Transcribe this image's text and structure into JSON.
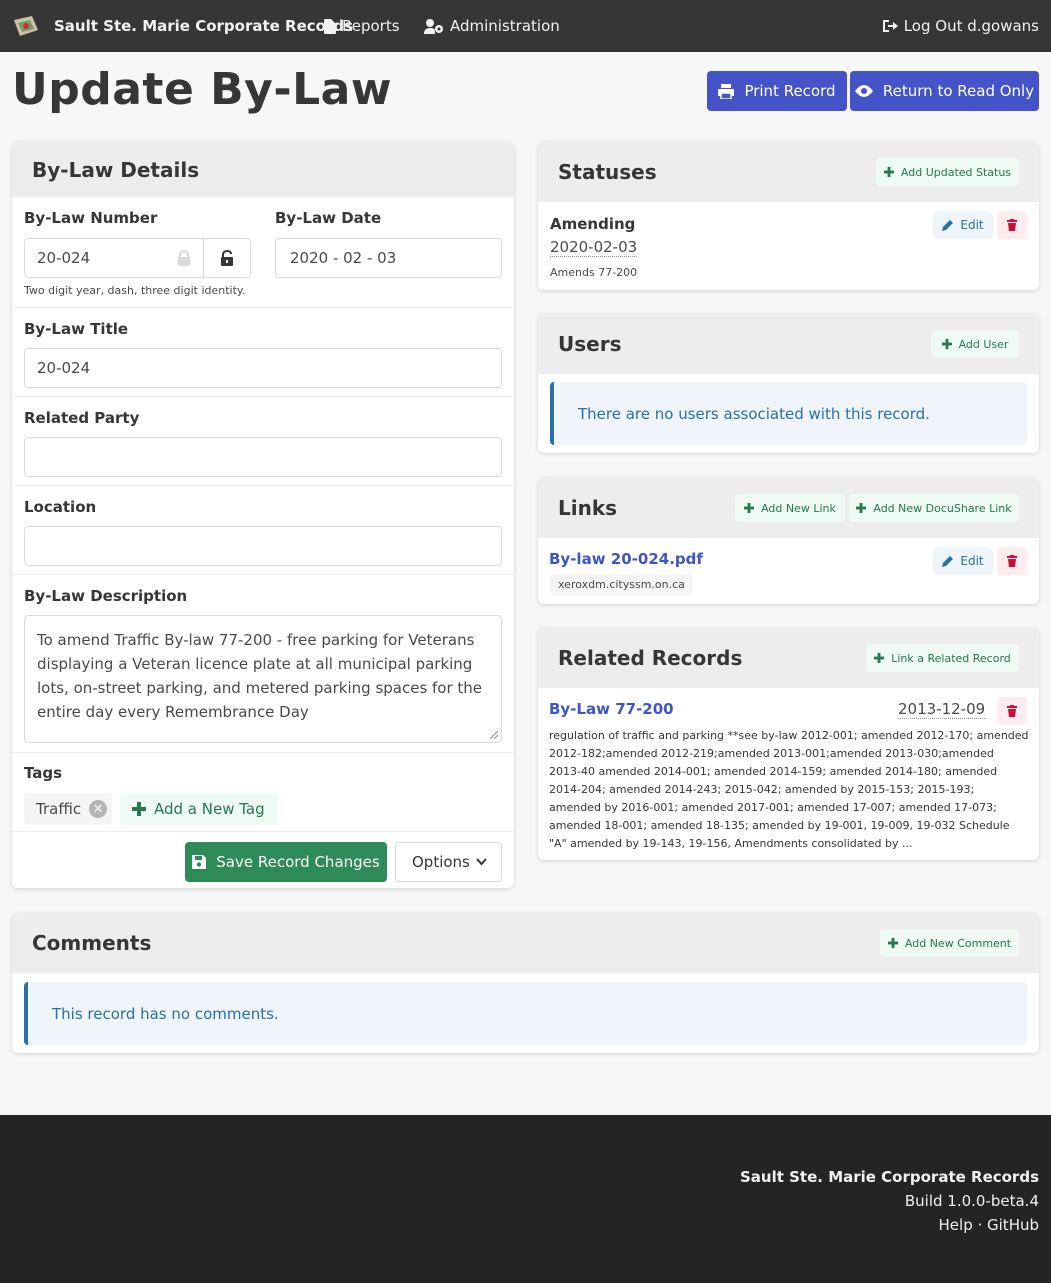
{
  "navbar": {
    "brand": "Sault Ste. Marie Corporate Records",
    "reports": "Reports",
    "administration": "Administration",
    "logout": "Log Out d.gowans"
  },
  "page": {
    "title": "Update By-Law",
    "print_button": "Print Record",
    "readonly_button": "Return to Read Only"
  },
  "details": {
    "heading": "By-Law Details",
    "number_label": "By-Law Number",
    "number_value": "20-024",
    "number_help": "Two digit year, dash, three digit identity.",
    "date_label": "By-Law Date",
    "date_value": "2020 - 02 - 03",
    "title_label": "By-Law Title",
    "title_value": "20-024",
    "party_label": "Related Party",
    "party_value": "",
    "location_label": "Location",
    "location_value": "",
    "description_label": "By-Law Description",
    "description_value": "To amend Traffic By-law 77-200 - free parking for Veterans displaying a Veteran licence plate at all municipal parking lots, on-street parking, and metered parking spaces for the entire day every Remembrance Day",
    "tags_label": "Tags",
    "tags": [
      "Traffic"
    ],
    "add_tag": "Add a New Tag",
    "save_button": "Save Record Changes",
    "options_button": "Options"
  },
  "statuses": {
    "heading": "Statuses",
    "add_button": "Add Updated Status",
    "items": [
      {
        "name": "Amending",
        "date": "2020-02-03",
        "note": "Amends 77-200",
        "edit": "Edit"
      }
    ]
  },
  "users": {
    "heading": "Users",
    "add_button": "Add User",
    "empty": "There are no users associated with this record."
  },
  "links": {
    "heading": "Links",
    "add_button": "Add New Link",
    "add_docushare": "Add New DocuShare Link",
    "items": [
      {
        "name": "By-law 20-024.pdf",
        "host": "xeroxdm.cityssm.on.ca",
        "edit": "Edit"
      }
    ]
  },
  "related": {
    "heading": "Related Records",
    "add_button": "Link a Related Record",
    "items": [
      {
        "name": "By-Law 77-200",
        "date": "2013-12-09",
        "description": "regulation of traffic and parking **see by-law 2012-001; amended 2012-170; amended 2012-182;amended 2012-219;amended 2013-001;amended 2013-030;amended 2013-40 amended 2014-001; amended 2014-159; amended 2014-180; amended 2014-204; amended 2014-243; 2015-042; amended by 2015-153; 2015-193; amended by 2016-001; amended 2017-001; amended 17-007; amended 17-073; amended 18-001; amended 18-135; amended by 19-001, 19-009, 19-032 Schedule \"A\" amended by 19-143, 19-156, Amendments consolidated by ..."
      }
    ]
  },
  "comments": {
    "heading": "Comments",
    "add_button": "Add New Comment",
    "empty": "This record has no comments."
  },
  "footer": {
    "name": "Sault Ste. Marie Corporate Records",
    "build": "Build 1.0.0-beta.4",
    "links": "Help · GitHub"
  }
}
